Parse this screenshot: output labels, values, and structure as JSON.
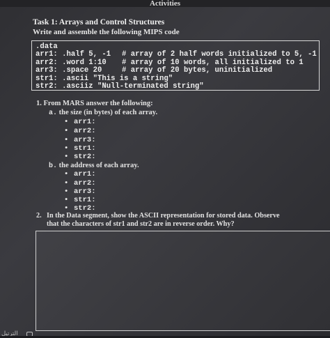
{
  "header": {
    "title": "Activities"
  },
  "task": {
    "title": "Task 1: Arrays and Control Structures",
    "instruction": "Write and assemble the following MIPS code"
  },
  "code": [
    {
      "directive": ".data",
      "comment": ""
    },
    {
      "directive": "arr1: .half 5, -1",
      "comment": "# array of 2 half words initialized to 5, -1"
    },
    {
      "directive": "arr2: .word 1:10",
      "comment": "# array of 10 words, all initialized to 1"
    },
    {
      "directive": "arr3: .space 20",
      "comment": "# array of 20 bytes, uninitialized"
    },
    {
      "directive": "str1: .ascii \"This is a string\"",
      "comment": ""
    },
    {
      "directive": "str2: .asciiz \"Null-terminated string\"",
      "comment": ""
    }
  ],
  "question1": {
    "number": "1.",
    "text": "From MARS answer the following:",
    "part_a": {
      "letter": "a.",
      "text": "the size (in bytes) of each array.",
      "items": [
        "arr1:",
        "arr2:",
        "arr3:",
        "str1:",
        "str2:"
      ]
    },
    "part_b": {
      "letter": "b.",
      "text": "the address of each array.",
      "items": [
        "arr1:",
        "arr2:",
        "arr3:",
        "str1:",
        "str2:"
      ]
    }
  },
  "question2": {
    "number": "2.",
    "text": "In the Data segment, show the ASCII representation for stored data. Observe that the characters of str1 and str2 are in reverse order. Why?"
  },
  "taskbar": {
    "label": "الترتيل"
  },
  "bullet_glyph": "•"
}
